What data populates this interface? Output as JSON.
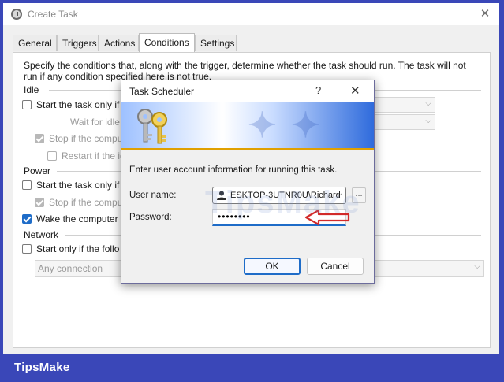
{
  "window": {
    "title": "Create Task",
    "close_glyph": "✕"
  },
  "tabs": [
    "General",
    "Triggers",
    "Actions",
    "Conditions",
    "Settings"
  ],
  "active_tab": "Conditions",
  "conditions": {
    "description": "Specify the conditions that, along with the trigger, determine whether the task should run.  The task will not run  if any condition specified here is not true.",
    "idle_header": "Idle",
    "idle_start_label": "Start the task only if",
    "idle_wait_label": "Wait for idle",
    "idle_stop_label": "Stop if the compu",
    "idle_restart_label": "Restart if the id",
    "power_header": "Power",
    "power_start_label": "Start the task only if",
    "power_stop_label": "Stop if the compu",
    "wake_label": "Wake the computer",
    "network_header": "Network",
    "network_start_label": "Start only if the follo",
    "network_connection": "Any connection"
  },
  "dialog": {
    "title": "Task Scheduler",
    "help_glyph": "?",
    "close_glyph": "✕",
    "message": "Enter user account information for running this task.",
    "user_label": "User name:",
    "user_value": "ESKTOP-3UTNR0U\\Richard",
    "browse_label": "...",
    "password_label": "Password:",
    "password_mask": "••••••••",
    "ok_label": "OK",
    "cancel_label": "Cancel"
  },
  "watermark": "TipsMake",
  "brand": "TipsMake",
  "colors": {
    "accent": "#1e6cc8",
    "frame": "#3a47b8",
    "arrow": "#d22a2a"
  }
}
